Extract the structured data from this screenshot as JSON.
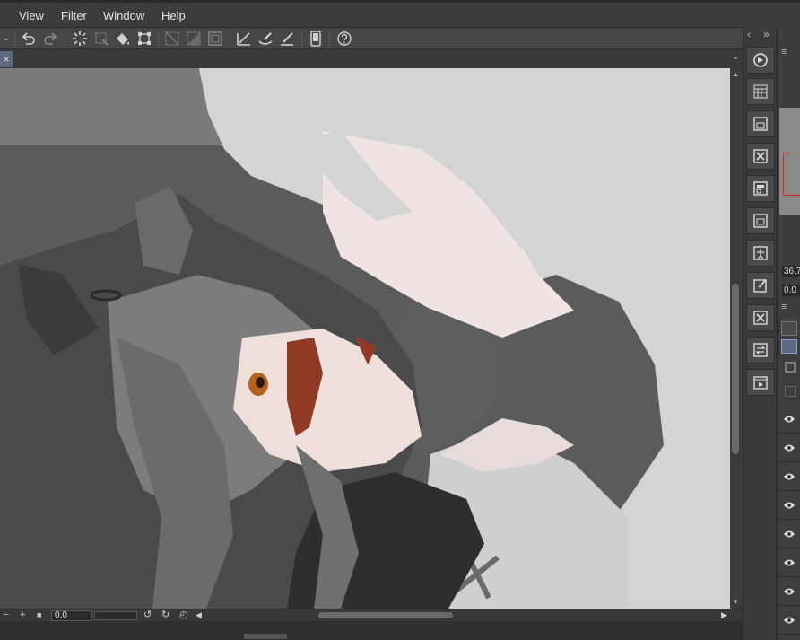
{
  "menu": {
    "items": [
      "View",
      "Filter",
      "Window",
      "Help"
    ]
  },
  "toolbar": {
    "icons": [
      "dropdown-arrow-icon",
      "undo-icon",
      "redo-icon",
      "loading-spinner-icon",
      "clear-icon",
      "fill-icon",
      "transform-icon",
      "select-all-icon",
      "invert-selection-icon",
      "deselect-icon",
      "ruler-icon",
      "brush-ruler-icon",
      "pen-ruler-icon",
      "smartphone-icon",
      "help-icon"
    ]
  },
  "tabbar": {
    "close_glyph": "×",
    "menu_glyph": "⌄"
  },
  "canvas": {
    "description_colors": {
      "background": "#5b5b5b",
      "hair_white": "#d6d6d6",
      "skin": "#f0e4e2",
      "hair_dark": "#3e3e3e"
    }
  },
  "statusbar": {
    "minus": "−",
    "plus": "+",
    "zoom_value": "0.0"
  },
  "right_panel": {
    "field_zoom": "36.7",
    "field_angle": "0.0",
    "header_glyph": "≡"
  },
  "side_strip": {
    "collapse_left": "‹",
    "collapse_right": "»"
  },
  "colors": {
    "accent_red": "#e02020",
    "panel_bg": "#3a3a3a",
    "toolbar_bg": "#464646"
  }
}
